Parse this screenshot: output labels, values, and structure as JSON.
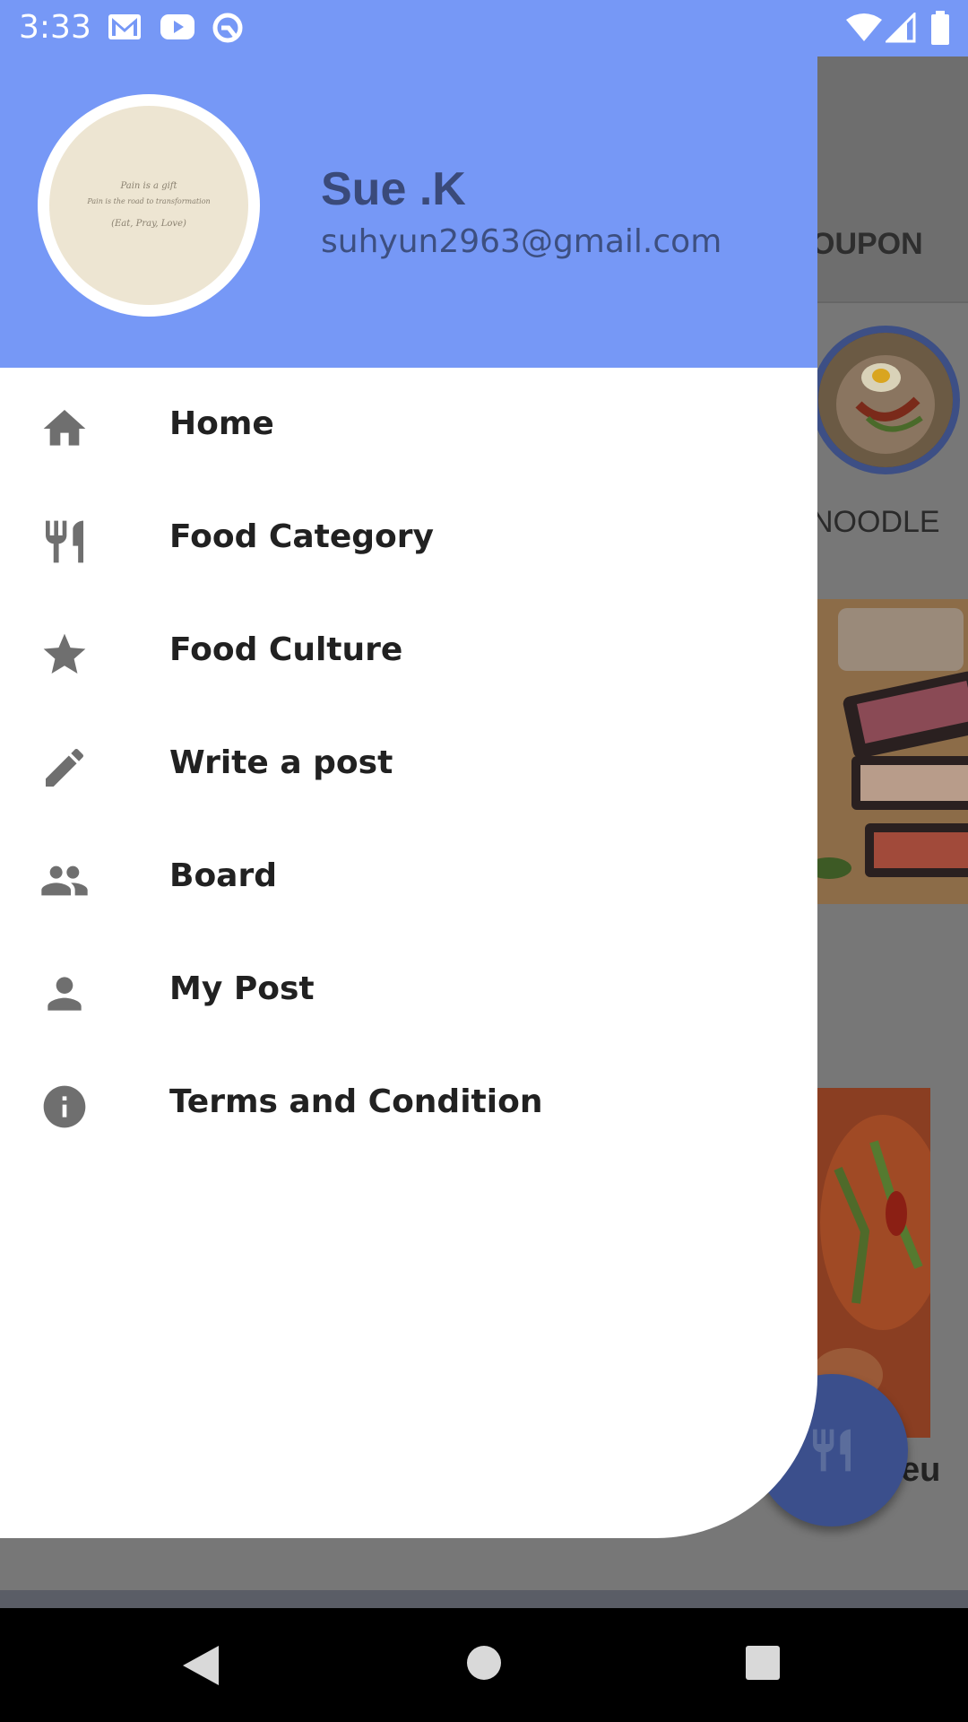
{
  "status_bar": {
    "time": "3:33",
    "icons_left": [
      "gmail-icon",
      "youtube-icon",
      "sync-icon"
    ],
    "icons_right": [
      "wifi-icon",
      "signal-icon",
      "battery-icon"
    ]
  },
  "background": {
    "tab_partial": "OUPON",
    "category_label_partial": "NOODLE",
    "card_text_partial": "eu"
  },
  "drawer": {
    "header_color": "#7698f6",
    "user": {
      "name": "Sue .K",
      "email": "suhyun2963@gmail.com",
      "avatar_quote": [
        "Pain is a gift",
        "Pain is the road to transformation",
        "(Eat, Pray, Love)"
      ]
    },
    "menu": [
      {
        "label": "Home",
        "icon": "home-icon"
      },
      {
        "label": "Food Category",
        "icon": "restaurant-icon"
      },
      {
        "label": "Food Culture",
        "icon": "star-icon"
      },
      {
        "label": "Write a post",
        "icon": "pencil-icon"
      },
      {
        "label": "Board",
        "icon": "people-icon"
      },
      {
        "label": "My Post",
        "icon": "person-icon"
      },
      {
        "label": "Terms and Condition",
        "icon": "info-icon"
      }
    ]
  },
  "fab": {
    "icon": "restaurant-icon"
  },
  "nav_bar": {
    "buttons": [
      "back-icon",
      "home-circle-icon",
      "recents-icon"
    ]
  }
}
